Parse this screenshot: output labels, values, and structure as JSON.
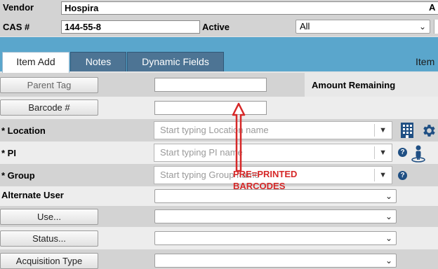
{
  "header": {
    "vendor_label": "Vendor",
    "vendor_value": "Hospira",
    "vendor_right_fragment": "A",
    "cas_label": "CAS #",
    "cas_value": "144-55-8",
    "active_label": "Active",
    "active_value": "All"
  },
  "tabs": [
    {
      "label": "Item Add",
      "active": true
    },
    {
      "label": "Notes",
      "active": false
    },
    {
      "label": "Dynamic Fields",
      "active": false
    }
  ],
  "tabbar_right_label": "Item",
  "form": {
    "parent_tag_button": "Parent Tag",
    "amount_remaining_label": "Amount Remaining",
    "barcode_button": "Barcode #",
    "location_label": "* Location",
    "location_placeholder": "Start typing Location name",
    "pi_label": "* PI",
    "pi_placeholder": "Start typing PI name",
    "group_label": "* Group",
    "group_placeholder": "Start typing Group name",
    "alternate_user_label": "Alternate User",
    "use_button": "Use...",
    "status_button": "Status...",
    "acquisition_type_button": "Acquisition Type"
  },
  "annotation": {
    "line1": "PRE=PRINTED",
    "line2": "BARCODES",
    "color": "#d62828"
  },
  "colors": {
    "tabbar": "#5aa6cc",
    "tab_inactive": "#4d7494",
    "icon_blue": "#1f4f83"
  },
  "icons": [
    "building-icon",
    "gear-icon",
    "help-icon",
    "person-icon",
    "dropdown-arrow-icon"
  ]
}
